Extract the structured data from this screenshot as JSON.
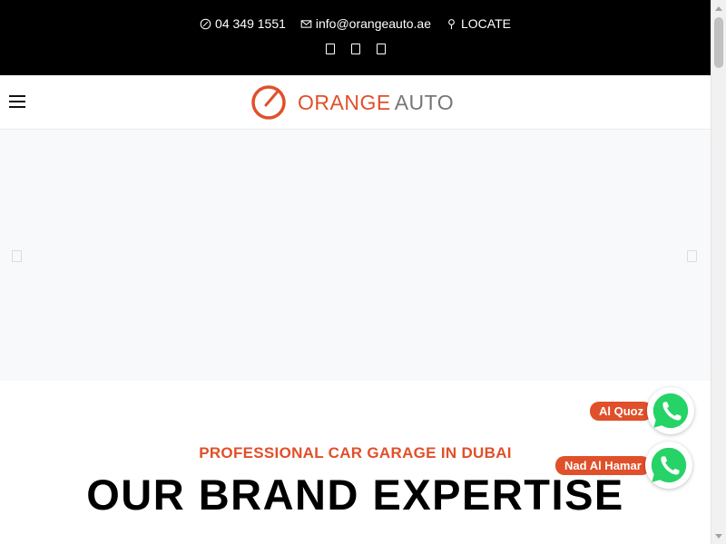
{
  "topbar": {
    "phone": {
      "text": "04 349 1551",
      "icon": "phone-icon"
    },
    "email": {
      "text": "info@orangeauto.ae",
      "icon": "mail-icon"
    },
    "locate": {
      "text": "LOCATE",
      "icon": "map-pin-icon"
    },
    "social": [
      {
        "icon": "facebook-icon"
      },
      {
        "icon": "instagram-icon"
      },
      {
        "icon": "youtube-icon"
      }
    ]
  },
  "header": {
    "menu_icon": "hamburger-icon",
    "logo": {
      "part1": "ORANGE",
      "part2": "AUTO"
    }
  },
  "slider": {
    "prev_icon": "chevron-left-icon",
    "next_icon": "chevron-right-icon"
  },
  "main": {
    "kicker": "PROFESSIONAL CAR GARAGE IN DUBAI",
    "headline": "OUR BRAND EXPERTISE"
  },
  "whatsapp": [
    {
      "label": "Al Quoz",
      "icon": "whatsapp-icon"
    },
    {
      "label": "Nad Al Hamar",
      "icon": "whatsapp-icon"
    }
  ],
  "colors": {
    "brand_orange": "#e0502a",
    "topbar_bg": "#000000",
    "whatsapp_green": "#25d366",
    "slider_bg": "#f8f9fb"
  }
}
